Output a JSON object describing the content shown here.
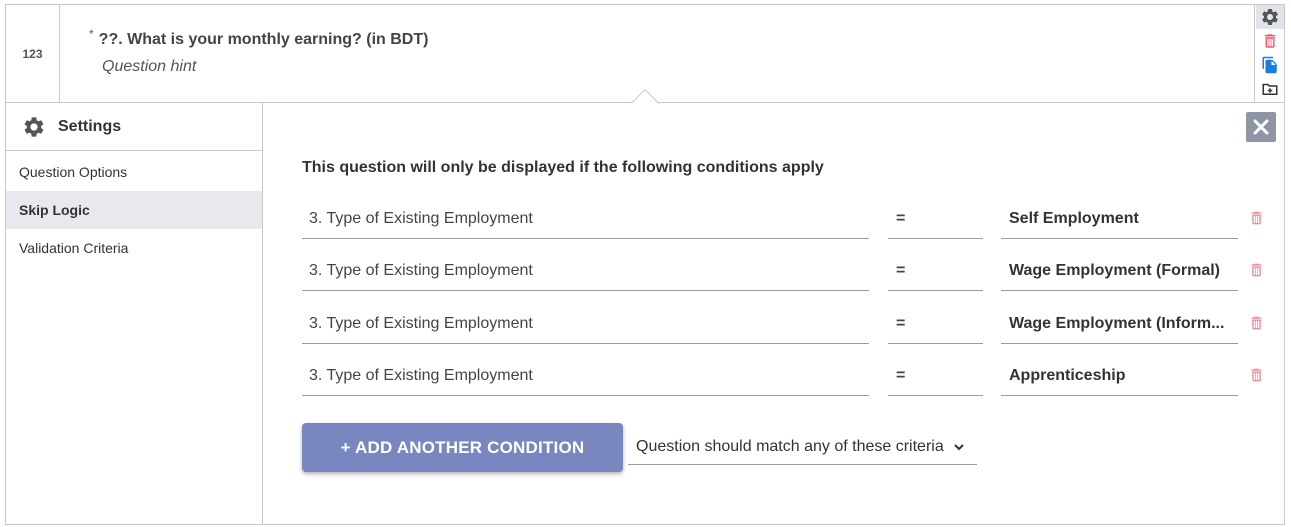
{
  "question": {
    "type_label": "123",
    "required_mark": "*",
    "text": "??. What is your monthly earning? (in BDT)",
    "hint": "Question hint"
  },
  "toolbar": {
    "icons": [
      "gear-icon",
      "trash-icon",
      "copy-icon",
      "folder-add-icon"
    ],
    "colors": {
      "gear": "#555555",
      "trash": "#f05a6e",
      "copy": "#1a7de6",
      "folder": "#333333"
    }
  },
  "sidebar": {
    "title": "Settings",
    "items": [
      {
        "label": "Question Options",
        "active": false
      },
      {
        "label": "Skip Logic",
        "active": true
      },
      {
        "label": "Validation Criteria",
        "active": false
      }
    ]
  },
  "skip_logic": {
    "title": "This question will only be displayed if the following conditions apply",
    "conditions": [
      {
        "question": "3. Type of Existing Employment",
        "operator": "=",
        "value": "Self Employment"
      },
      {
        "question": "3. Type of Existing Employment",
        "operator": "=",
        "value": "Wage Employment (Formal)"
      },
      {
        "question": "3. Type of Existing Employment",
        "operator": "=",
        "value": "Wage Employment (Inform..."
      },
      {
        "question": "3. Type of Existing Employment",
        "operator": "=",
        "value": "Apprenticeship"
      }
    ],
    "add_label": "+ ADD ANOTHER CONDITION",
    "match_label": "Question should match any of these criteria"
  },
  "colors": {
    "accent_button": "#7887c0",
    "close_button": "#8e96a6",
    "delete_icon": "#f58a96",
    "active_sidebar": "#e8e9ef"
  }
}
